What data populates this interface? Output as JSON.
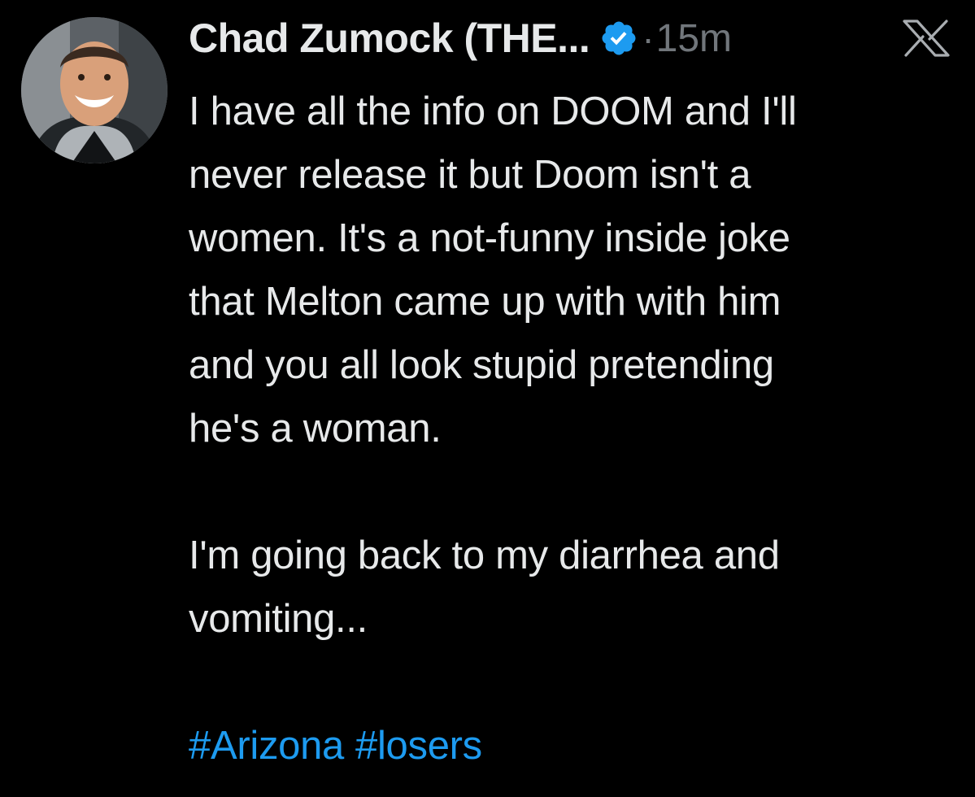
{
  "tweet": {
    "author": {
      "display_name": "Chad Zumock (THE...",
      "verified": true,
      "avatar_icon": "user-avatar"
    },
    "separator": "·",
    "timestamp": "15m",
    "platform_icon": "x-logo-icon",
    "body": {
      "paragraph_1": "I have all the info on DOOM and I'll\nnever release it but Doom isn't a\nwomen. It's a not-funny inside joke\nthat Melton came up with with him\nand you all look stupid pretending\nhe's a woman.",
      "paragraph_2": "I'm going back to my diarrhea and\nvomiting...",
      "hashtags": [
        "#Arizona",
        "#losers"
      ]
    }
  },
  "colors": {
    "background": "#000000",
    "text_primary": "#e7e9ea",
    "text_secondary": "#71767b",
    "link": "#1d9bf0",
    "verified_badge": "#1d9bf0"
  }
}
